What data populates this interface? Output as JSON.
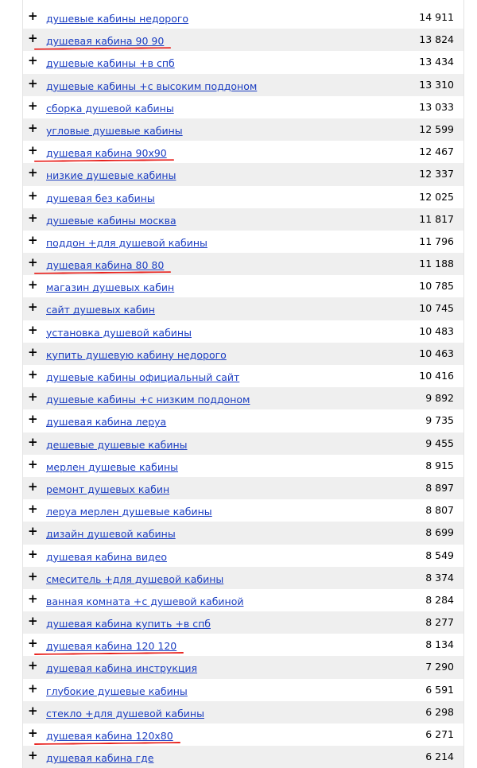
{
  "accent_color": "#e8201c",
  "link_color": "#1a3dc1",
  "add_icon": "plus-icon",
  "rows": [
    {
      "phrase": "душевые кабины недорого",
      "count": "14 911"
    },
    {
      "phrase": "душевая кабина 90 90",
      "count": "13 824",
      "marked": true
    },
    {
      "phrase": "душевые кабины +в спб",
      "count": "13 434"
    },
    {
      "phrase": "душевые кабины +с высоким поддоном",
      "count": "13 310"
    },
    {
      "phrase": "сборка душевой кабины",
      "count": "13 033"
    },
    {
      "phrase": "угловые душевые кабины",
      "count": "12 599"
    },
    {
      "phrase": "душевая кабина 90х90",
      "count": "12 467",
      "marked": true
    },
    {
      "phrase": "низкие душевые кабины",
      "count": "12 337"
    },
    {
      "phrase": "душевая без кабины",
      "count": "12 025"
    },
    {
      "phrase": "душевые кабины москва",
      "count": "11 817"
    },
    {
      "phrase": "поддон +для душевой кабины",
      "count": "11 796"
    },
    {
      "phrase": "душевая кабина 80 80",
      "count": "11 188",
      "marked": true
    },
    {
      "phrase": "магазин душевых кабин",
      "count": "10 785"
    },
    {
      "phrase": "сайт душевых кабин",
      "count": "10 745"
    },
    {
      "phrase": "установка душевой кабины",
      "count": "10 483"
    },
    {
      "phrase": "купить душевую кабину недорого",
      "count": "10 463"
    },
    {
      "phrase": "душевые кабины официальный сайт",
      "count": "10 416"
    },
    {
      "phrase": "душевые кабины +с низким поддоном",
      "count": "9 892"
    },
    {
      "phrase": "душевая кабина леруа",
      "count": "9 735"
    },
    {
      "phrase": "дешевые душевые кабины",
      "count": "9 455"
    },
    {
      "phrase": "мерлен душевые кабины",
      "count": "8 915"
    },
    {
      "phrase": "ремонт душевых кабин",
      "count": "8 897"
    },
    {
      "phrase": "леруа мерлен душевые кабины",
      "count": "8 807"
    },
    {
      "phrase": "дизайн душевой кабины",
      "count": "8 699"
    },
    {
      "phrase": "душевая кабина видео",
      "count": "8 549"
    },
    {
      "phrase": "смеситель +для душевой кабины",
      "count": "8 374"
    },
    {
      "phrase": "ванная комната +с душевой кабиной",
      "count": "8 284"
    },
    {
      "phrase": "душевая кабина купить +в спб",
      "count": "8 277"
    },
    {
      "phrase": "душевая кабина 120 120",
      "count": "8 134",
      "marked": true
    },
    {
      "phrase": "душевая кабина инструкция",
      "count": "7 290"
    },
    {
      "phrase": "глубокие душевые кабины",
      "count": "6 591"
    },
    {
      "phrase": "стекло +для душевой кабины",
      "count": "6 298"
    },
    {
      "phrase": "душевая кабина 120х80",
      "count": "6 271",
      "marked": true
    },
    {
      "phrase": "душевая кабина где",
      "count": "6 214"
    }
  ]
}
